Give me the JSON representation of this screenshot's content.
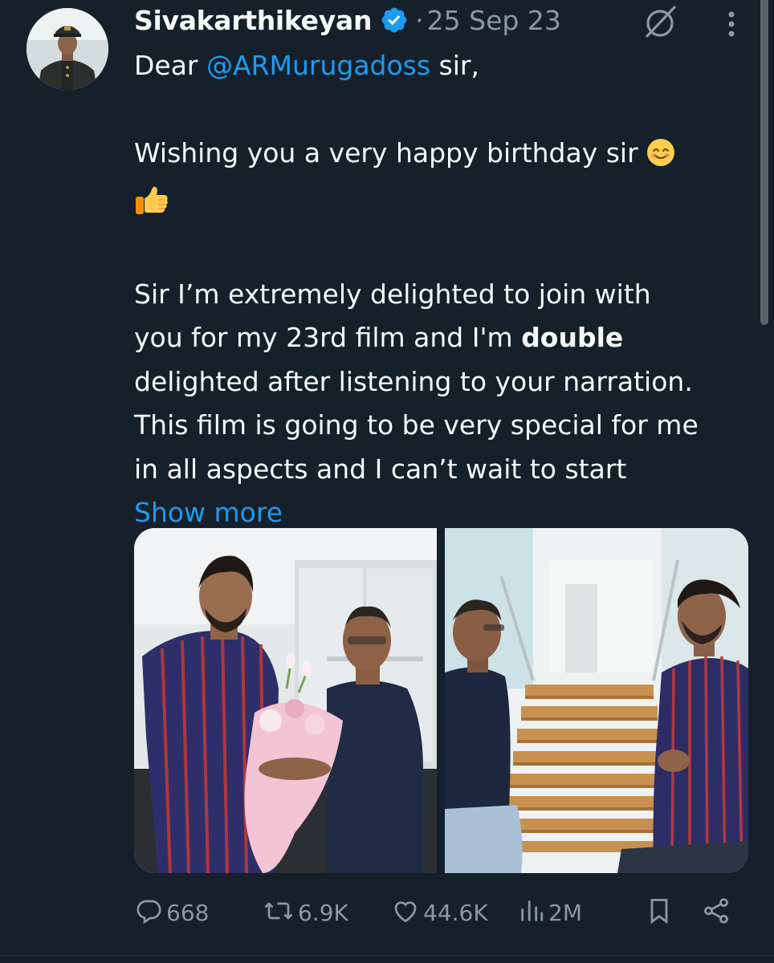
{
  "author": {
    "display_name": "Sivakarthikeyan",
    "verified": true,
    "separator": "·",
    "date": "25 Sep 23"
  },
  "tweet": {
    "greeting_prefix": "Dear ",
    "mention": "@ARMurugadoss",
    "greeting_suffix": " sir,",
    "line_wish": "Wishing you a very happy birthday sir",
    "para_1": "Sir I’m extremely delighted to join with",
    "para_2a": "you for my 23rd film and I'm ",
    "para_2_bold": "double",
    "para_3": "delighted after listening to your narration.",
    "para_4": "This film is going to be very special for me",
    "para_5": "in all aspects and I can’t wait to start",
    "show_more": "Show more"
  },
  "media": {
    "count": 2,
    "photos": [
      {
        "icon": "photo-two-men-bouquet"
      },
      {
        "icon": "photo-two-men-staircase"
      }
    ]
  },
  "actions": {
    "replies": "668",
    "reposts": "6.9K",
    "likes": "44.6K",
    "views": "2M"
  },
  "colors": {
    "background": "#15202b",
    "text": "#f7f9f9",
    "secondary": "#8b98a5",
    "accent": "#1d9bf0"
  }
}
